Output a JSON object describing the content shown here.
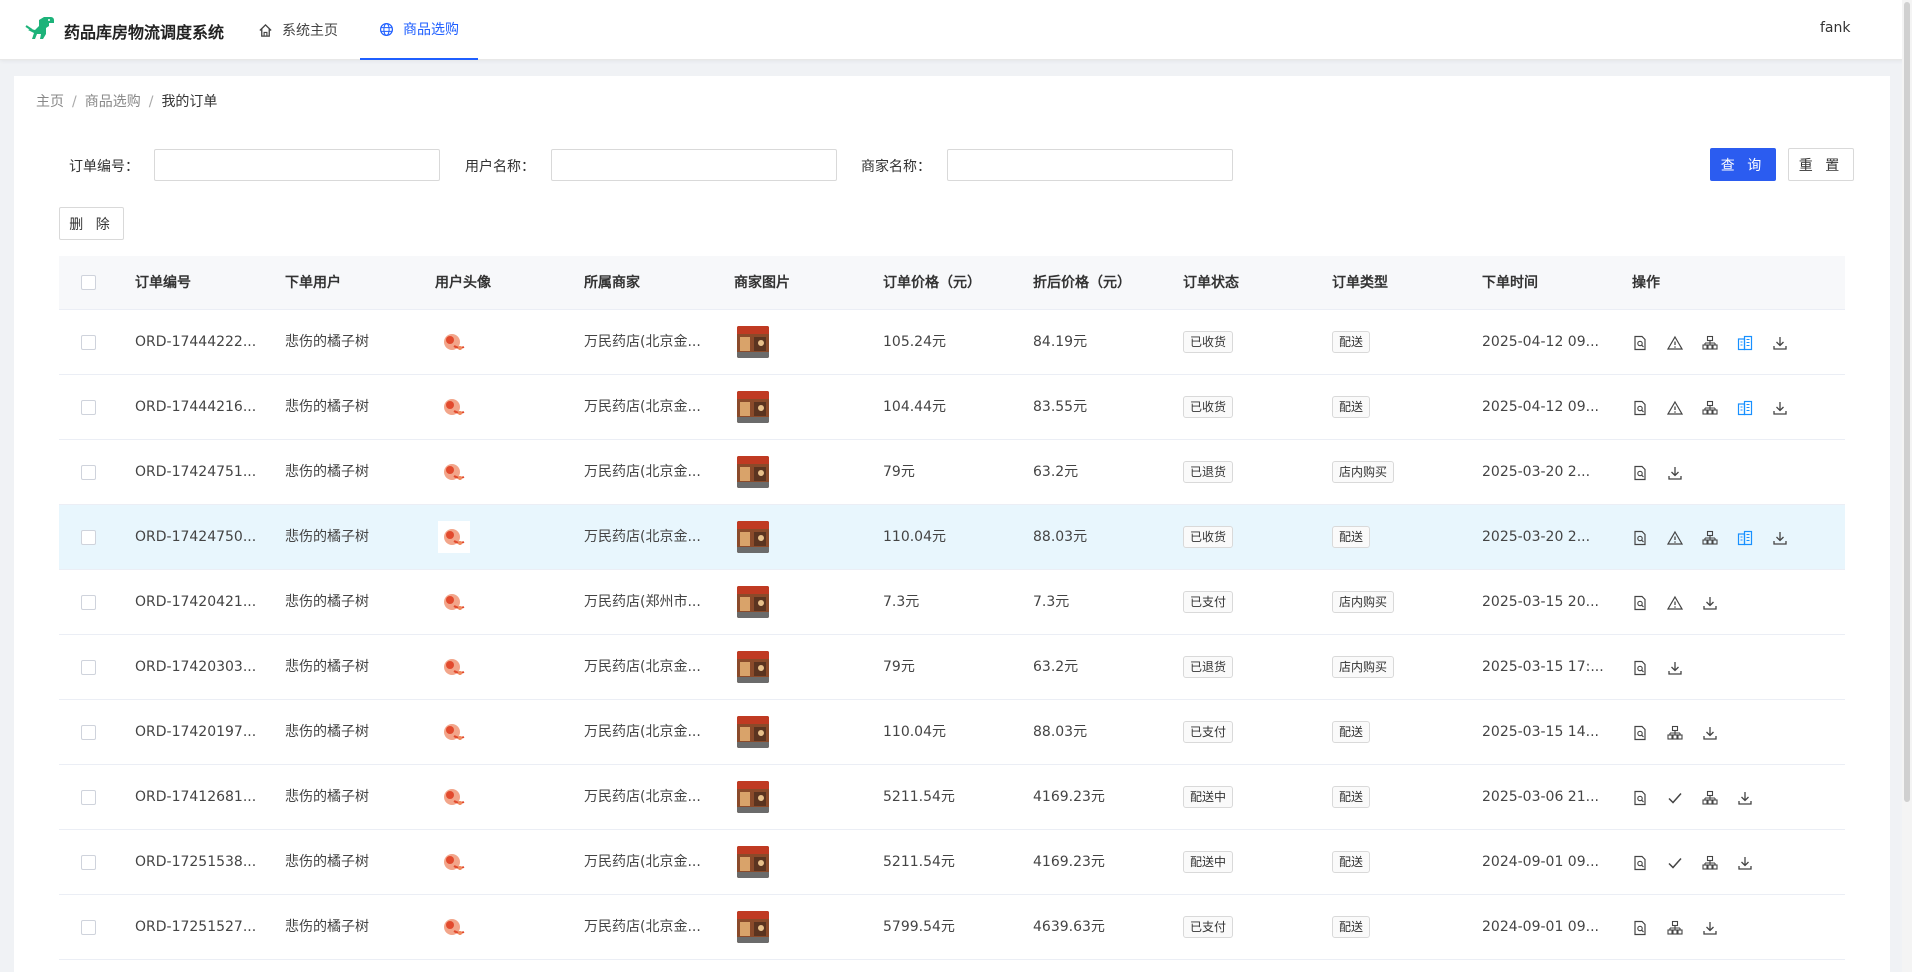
{
  "header": {
    "brand": "药品库房物流调度系统",
    "nav": [
      {
        "label": "系统主页",
        "icon": "home-icon"
      },
      {
        "label": "商品选购",
        "icon": "globe-icon",
        "active": true
      }
    ],
    "user": "fank",
    "accent": "#1f5fff"
  },
  "breadcrumb": [
    "主页",
    "商品选购",
    "我的订单"
  ],
  "filters": {
    "order_no_label": "订单编号：",
    "user_name_label": "用户名称：",
    "shop_name_label": "商家名称：",
    "order_no_value": "",
    "user_name_value": "",
    "shop_name_value": "",
    "query_label": "查 询",
    "reset_label": "重 置"
  },
  "toolbar": {
    "delete_label": "删 除"
  },
  "table": {
    "columns": [
      "订单编号",
      "下单用户",
      "用户头像",
      "所属商家",
      "商家图片",
      "订单价格（元）",
      "折后价格（元）",
      "订单状态",
      "订单类型",
      "下单时间",
      "操作"
    ],
    "rows": [
      {
        "order_no": "ORD-17444222...",
        "user": "悲伤的橘子树",
        "shop": "万民药店(北京金...",
        "price": "105.24元",
        "discount": "84.19元",
        "status": "已收货",
        "type": "配送",
        "time": "2025-04-12 09...",
        "ops": [
          "detail-icon",
          "warning-icon",
          "org-icon",
          "building-icon",
          "download-icon"
        ]
      },
      {
        "order_no": "ORD-17444216...",
        "user": "悲伤的橘子树",
        "shop": "万民药店(北京金...",
        "price": "104.44元",
        "discount": "83.55元",
        "status": "已收货",
        "type": "配送",
        "time": "2025-04-12 09...",
        "ops": [
          "detail-icon",
          "warning-icon",
          "org-icon",
          "building-icon",
          "download-icon"
        ]
      },
      {
        "order_no": "ORD-17424751...",
        "user": "悲伤的橘子树",
        "shop": "万民药店(北京金...",
        "price": "79元",
        "discount": "63.2元",
        "status": "已退货",
        "type": "店内购买",
        "time": "2025-03-20 2...",
        "ops": [
          "detail-icon",
          "download-icon"
        ]
      },
      {
        "order_no": "ORD-17424750...",
        "user": "悲伤的橘子树",
        "shop": "万民药店(北京金...",
        "price": "110.04元",
        "discount": "88.03元",
        "status": "已收货",
        "type": "配送",
        "time": "2025-03-20 2...",
        "ops": [
          "detail-icon",
          "warning-icon",
          "org-icon",
          "building-icon",
          "download-icon"
        ],
        "highlight": true
      },
      {
        "order_no": "ORD-17420421...",
        "user": "悲伤的橘子树",
        "shop": "万民药店(郑州市...",
        "price": "7.3元",
        "discount": "7.3元",
        "status": "已支付",
        "type": "店内购买",
        "time": "2025-03-15 20...",
        "ops": [
          "detail-icon",
          "warning-icon",
          "download-icon"
        ]
      },
      {
        "order_no": "ORD-17420303...",
        "user": "悲伤的橘子树",
        "shop": "万民药店(北京金...",
        "price": "79元",
        "discount": "63.2元",
        "status": "已退货",
        "type": "店内购买",
        "time": "2025-03-15 17:...",
        "ops": [
          "detail-icon",
          "download-icon"
        ]
      },
      {
        "order_no": "ORD-17420197...",
        "user": "悲伤的橘子树",
        "shop": "万民药店(北京金...",
        "price": "110.04元",
        "discount": "88.03元",
        "status": "已支付",
        "type": "配送",
        "time": "2025-03-15 14...",
        "ops": [
          "detail-icon",
          "org-icon",
          "download-icon"
        ]
      },
      {
        "order_no": "ORD-17412681...",
        "user": "悲伤的橘子树",
        "shop": "万民药店(北京金...",
        "price": "5211.54元",
        "discount": "4169.23元",
        "status": "配送中",
        "type": "配送",
        "time": "2025-03-06 21...",
        "ops": [
          "detail-icon",
          "check-icon",
          "org-icon",
          "download-icon"
        ]
      },
      {
        "order_no": "ORD-17251538...",
        "user": "悲伤的橘子树",
        "shop": "万民药店(北京金...",
        "price": "5211.54元",
        "discount": "4169.23元",
        "status": "配送中",
        "type": "配送",
        "time": "2024-09-01 09...",
        "ops": [
          "detail-icon",
          "check-icon",
          "org-icon",
          "download-icon"
        ]
      },
      {
        "order_no": "ORD-17251527...",
        "user": "悲伤的橘子树",
        "shop": "万民药店(北京金...",
        "price": "5799.54元",
        "discount": "4639.63元",
        "status": "已支付",
        "type": "配送",
        "time": "2024-09-01 09...",
        "ops": [
          "detail-icon",
          "org-icon",
          "download-icon"
        ]
      }
    ]
  }
}
